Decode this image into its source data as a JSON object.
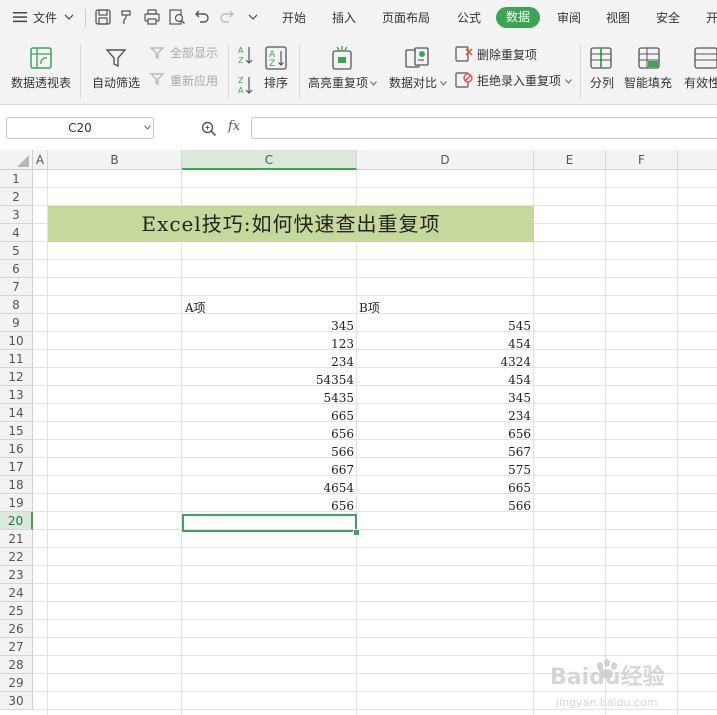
{
  "menubar": {
    "file_label": "文件",
    "tabs": [
      "开始",
      "插入",
      "页面布局",
      "公式",
      "数据",
      "审阅",
      "视图",
      "安全",
      "开"
    ],
    "active_tab": "数据"
  },
  "ribbon": {
    "pivot_label": "数据透视表",
    "autofilter_label": "自动筛选",
    "show_all_label": "全部显示",
    "reapply_label": "重新应用",
    "sort_label": "排序",
    "highlight_dup_label": "高亮重复项",
    "compare_label": "数据对比",
    "delete_dup_label": "删除重复项",
    "reject_dup_label": "拒绝录入重复项",
    "split_label": "分列",
    "flash_fill_label": "智能填充",
    "validity_label": "有效性"
  },
  "formula_bar": {
    "name_box": "C20",
    "fx_label": "fx",
    "formula": ""
  },
  "sheet": {
    "columns": [
      "A",
      "B",
      "C",
      "D",
      "E",
      "F"
    ],
    "selected_column": "C",
    "selected_row": "20",
    "rows": [
      "1",
      "2",
      "3",
      "4",
      "5",
      "6",
      "7",
      "8",
      "9",
      "10",
      "11",
      "12",
      "13",
      "14",
      "15",
      "16",
      "17",
      "18",
      "19",
      "20",
      "21",
      "22",
      "23",
      "24",
      "25",
      "26",
      "27",
      "28",
      "29",
      "30"
    ],
    "title": "Excel技巧:如何快速查出重复项",
    "header_a": "A项",
    "header_b": "B项",
    "col_a_values": [
      "345",
      "123",
      "234",
      "54354",
      "5435",
      "665",
      "656",
      "566",
      "667",
      "4654",
      "656"
    ],
    "col_b_values": [
      "545",
      "454",
      "4324",
      "454",
      "345",
      "234",
      "656",
      "567",
      "575",
      "665",
      "566"
    ]
  },
  "watermark": {
    "brand": "Baidu经验",
    "url": "jingyan.baidu.com"
  },
  "colors": {
    "accent": "#3aa655",
    "title_fill": "#c5d99c"
  }
}
